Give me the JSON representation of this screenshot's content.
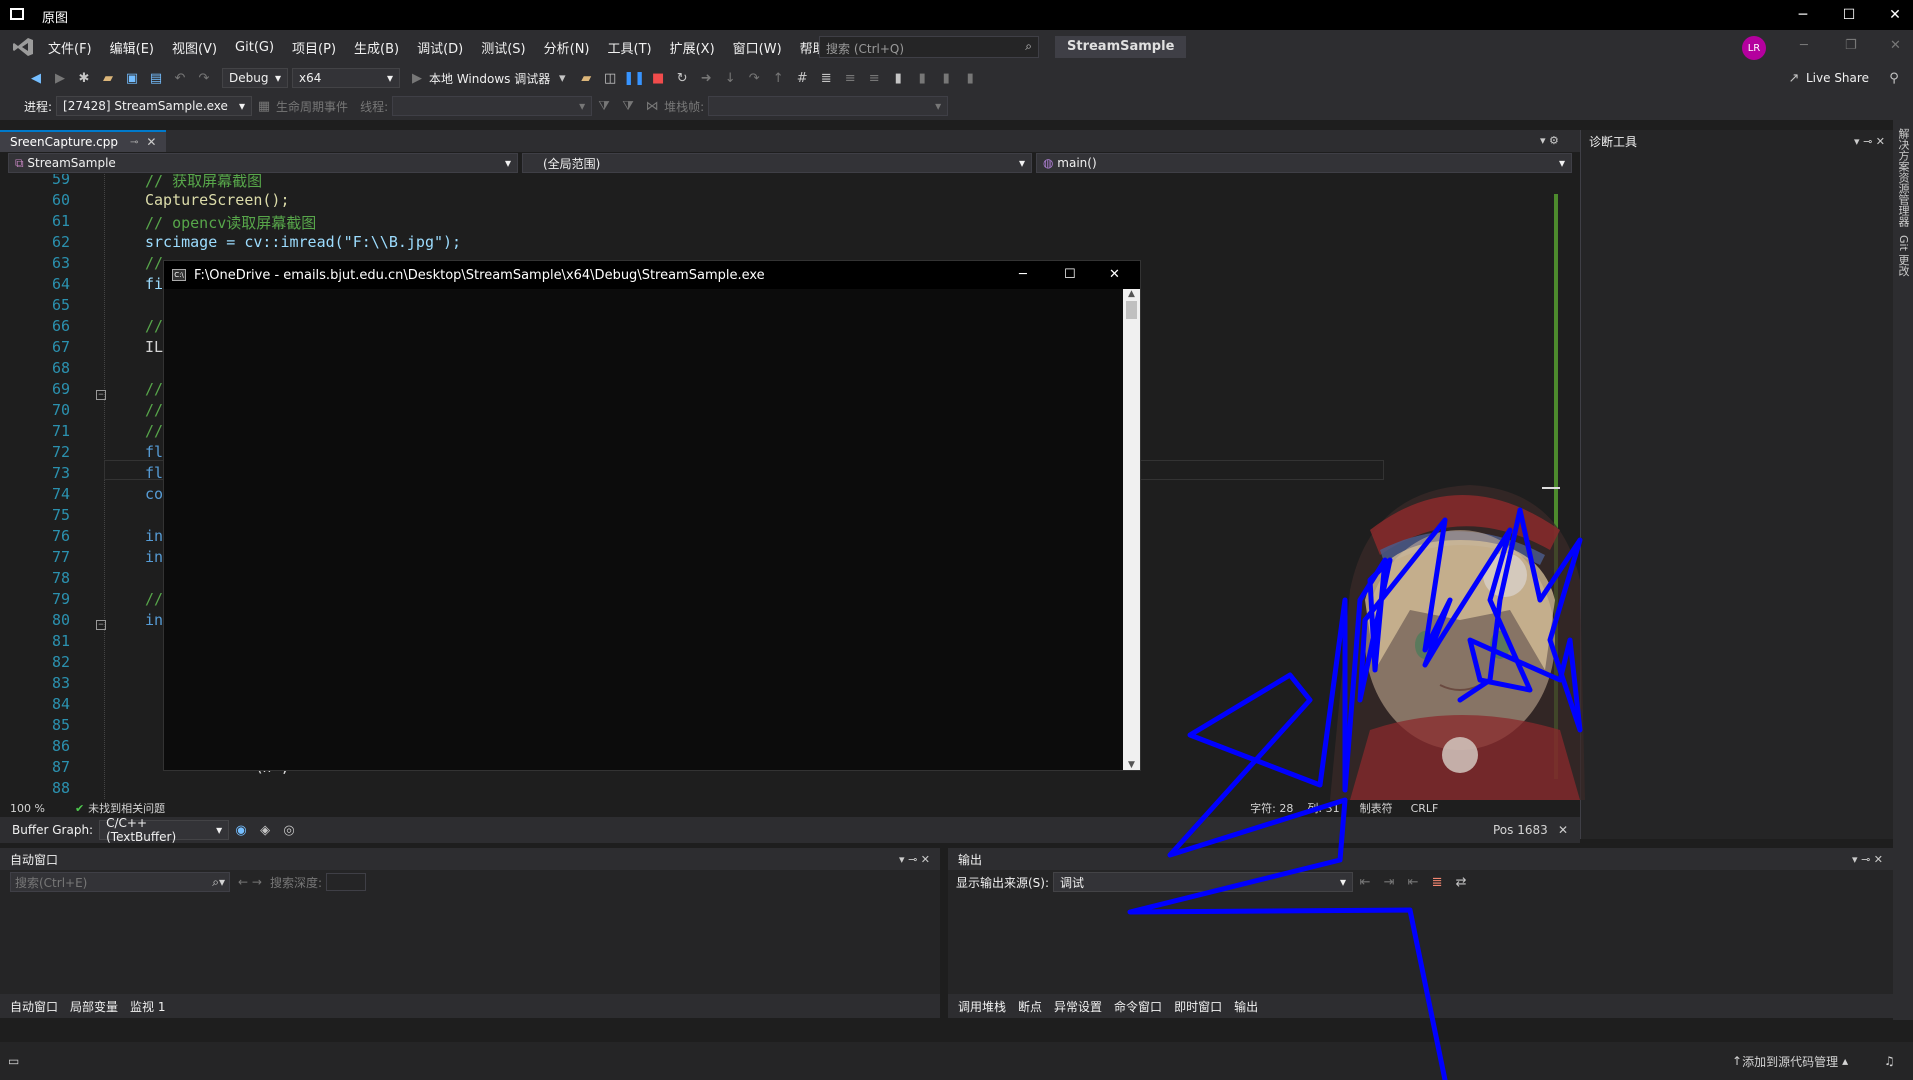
{
  "window": {
    "title": "原图"
  },
  "menubar": {
    "items": [
      "文件(F)",
      "编辑(E)",
      "视图(V)",
      "Git(G)",
      "项目(P)",
      "生成(B)",
      "调试(D)",
      "测试(S)",
      "分析(N)",
      "工具(T)",
      "扩展(X)",
      "窗口(W)",
      "帮助(H)"
    ],
    "search_placeholder": "搜索 (Ctrl+Q)",
    "solution_name": "StreamSample",
    "avatar_initials": "LR"
  },
  "toolbar1": {
    "config": "Debug",
    "platform": "x64",
    "run_label": "本地 Windows 调试器",
    "live_share": "Live Share"
  },
  "toolbar2": {
    "process_label": "进程:",
    "process_value": "[27428] StreamSample.exe",
    "lifecycle_label": "生命周期事件",
    "thread_label": "线程:",
    "stackframe_label": "堆栈帧:"
  },
  "editor_tab": {
    "filename": "SreenCapture.cpp"
  },
  "navbar": {
    "project": "StreamSample",
    "scope": "(全局范围)",
    "member": "main()"
  },
  "code_lines": [
    {
      "n": "59",
      "t": "// 获取屏幕截图",
      "c": "cm"
    },
    {
      "n": "60",
      "t": "CaptureScreen();",
      "c": "fn"
    },
    {
      "n": "61",
      "t": "// opencv读取屏幕截图",
      "c": "cm"
    },
    {
      "n": "62",
      "t": "srcimage = cv::imread(\"F:\\\\B.jpg\");",
      "c": "id"
    },
    {
      "n": "63",
      "t": "//",
      "c": "cm"
    },
    {
      "n": "64",
      "t": "fi",
      "c": "id"
    },
    {
      "n": "65",
      "t": "",
      "c": "pl"
    },
    {
      "n": "66",
      "t": "//",
      "c": "cm"
    },
    {
      "n": "67",
      "t": "IL",
      "c": "pl"
    },
    {
      "n": "68",
      "t": "",
      "c": "pl"
    },
    {
      "n": "69",
      "t": "//",
      "c": "cm"
    },
    {
      "n": "70",
      "t": "//",
      "c": "cm"
    },
    {
      "n": "71",
      "t": "//",
      "c": "cm"
    },
    {
      "n": "72",
      "t": "fl",
      "c": "kw"
    },
    {
      "n": "73",
      "t": "fl",
      "c": "kw"
    },
    {
      "n": "74",
      "t": "co",
      "c": "kw"
    },
    {
      "n": "75",
      "t": "",
      "c": "pl"
    },
    {
      "n": "76",
      "t": "in",
      "c": "kw"
    },
    {
      "n": "77",
      "t": "in",
      "c": "kw"
    },
    {
      "n": "78",
      "t": "",
      "c": "pl"
    },
    {
      "n": "79",
      "t": "//",
      "c": "cm"
    },
    {
      "n": "80",
      "t": "in",
      "c": "kw"
    },
    {
      "n": "81",
      "t": "",
      "c": "pl"
    },
    {
      "n": "82",
      "t": "",
      "c": "pl"
    },
    {
      "n": "83",
      "t": "",
      "c": "pl"
    },
    {
      "n": "84",
      "t": "",
      "c": "pl"
    },
    {
      "n": "85",
      "t": "",
      "c": "pl"
    },
    {
      "n": "86",
      "t": "",
      "c": "pl"
    },
    {
      "n": "87",
      "t": "        <<  \\n ;",
      "c": "pl"
    },
    {
      "n": "88",
      "t": "",
      "c": "pl"
    }
  ],
  "editor_status": {
    "zoom": "100 %",
    "issues": "未找到相关问题",
    "char": "字符: 28",
    "col": "列: 31",
    "tabs": "制表符",
    "eol": "CRLF",
    "pos": "Pos 1683"
  },
  "buffer_graph": {
    "label": "Buffer Graph:",
    "value": "C/C++ (TextBuffer)"
  },
  "diag_tools": {
    "title": "诊断工具"
  },
  "side_strip": {
    "items": [
      "解决方案资源管理器",
      "Git 更改"
    ]
  },
  "autos_panel": {
    "title": "自动窗口",
    "search_placeholder": "搜索(Ctrl+E)",
    "depth_label": "搜索深度:",
    "tabs": [
      "自动窗口",
      "局部变量",
      "监视 1"
    ]
  },
  "output_panel": {
    "title": "输出",
    "source_label": "显示输出来源(S):",
    "source_value": "调试",
    "tabs": [
      "调用堆栈",
      "断点",
      "异常设置",
      "命令窗口",
      "即时窗口",
      "输出"
    ]
  },
  "statusbar": {
    "source_control": "添加到源代码管理"
  },
  "console": {
    "title": "F:\\OneDrive - emails.bjut.edu.cn\\Desktop\\StreamSample\\x64\\Debug\\StreamSample.exe"
  },
  "colors": {
    "accent": "#007acc",
    "scribble": "#0000ff",
    "background": "#1e1e1e"
  }
}
